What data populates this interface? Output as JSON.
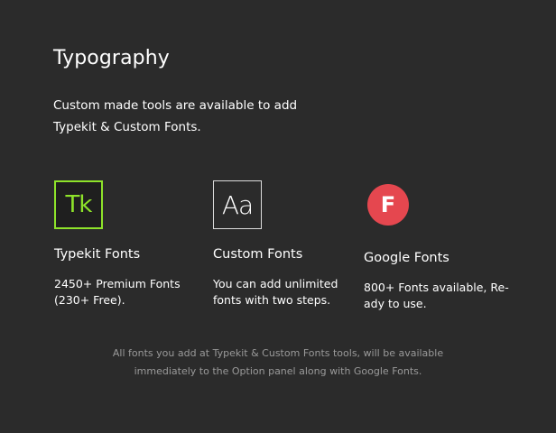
{
  "section": {
    "title": "Typography",
    "intro_lines": [
      "Custom made tools are available to add",
      "Typekit & Custom Fonts."
    ]
  },
  "features": [
    {
      "icon": "typekit-icon",
      "icon_text": "Tk",
      "title": "Typekit Fonts",
      "desc_lines": [
        "2450+ Premium Fonts",
        "(230+ Free)."
      ],
      "accent": "#8ee32a"
    },
    {
      "icon": "custom-font-icon",
      "icon_text": "Aa",
      "title": "Custom Fonts",
      "desc_lines": [
        "You can add unlimited",
        "fonts with two steps."
      ],
      "accent": "#dddddd"
    },
    {
      "icon": "google-fonts-icon",
      "icon_text": "F",
      "title": "Google Fonts",
      "desc_lines": [
        "800+ Fonts available, Re-",
        "ady to use."
      ],
      "accent": "#e5474f"
    }
  ],
  "footer_note_lines": [
    "All fonts you add at Typekit & Custom Fonts tools, will be available",
    "immediately to the Option panel along with Google Fonts."
  ],
  "colors": {
    "background": "#2b2b2b",
    "text": "#ffffff",
    "muted_text": "#9a9a9a"
  }
}
